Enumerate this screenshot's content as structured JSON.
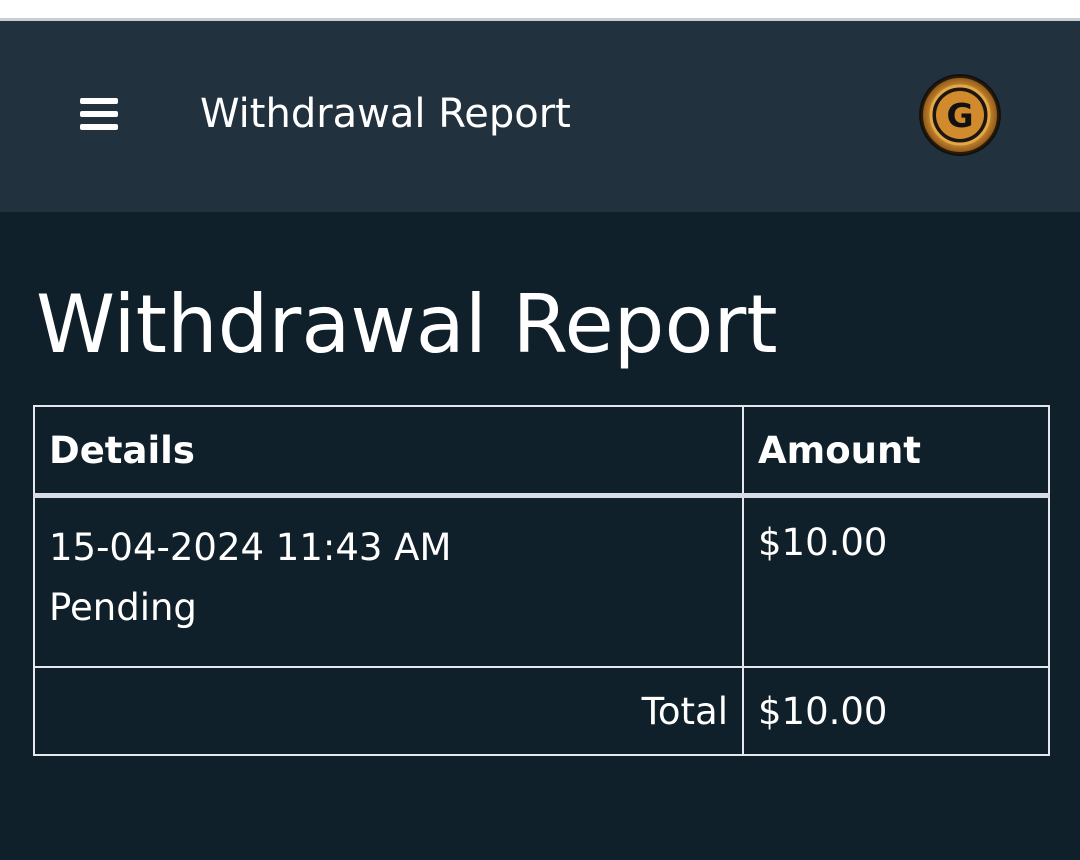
{
  "header": {
    "title": "Withdrawal Report",
    "menu_icon": "hamburger-menu-icon",
    "logo_icon": "gold-coin-logo-icon",
    "logo_letter": "G"
  },
  "page": {
    "title": "Withdrawal Report"
  },
  "table": {
    "columns": [
      "Details",
      "Amount"
    ],
    "rows": [
      {
        "datetime": "15-04-2024 11:43 AM",
        "status": "Pending",
        "amount": "$10.00"
      }
    ],
    "total_label": "Total",
    "total_amount": "$10.00"
  },
  "colors": {
    "background": "#10202a",
    "header_background": "#22313e",
    "text": "#ffffff",
    "border": "#e4e8ee",
    "logo_gold": "#c8922e"
  }
}
